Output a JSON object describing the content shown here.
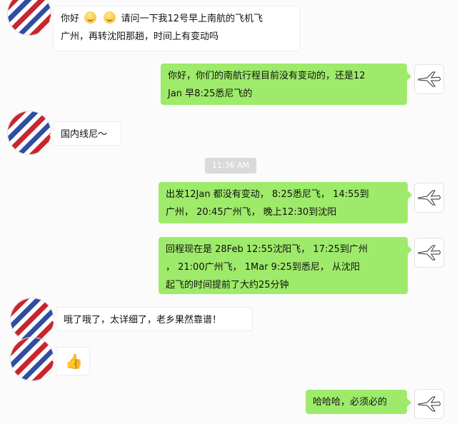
{
  "timestamp": "11:36 AM",
  "messages": [
    {
      "side": "left",
      "lines": [
        "你好",
        "请问一下我12号早上南航的飞机飞",
        "广州，再转沈阳那趟，时间上有变动吗"
      ]
    },
    {
      "side": "right",
      "lines": [
        "你好，你们的南航行程目前没有变动的，还是12",
        "Jan  早8:25悉尼飞的"
      ]
    },
    {
      "side": "left",
      "lines": [
        "国内线尼～"
      ]
    },
    {
      "side": "right",
      "lines": [
        "出发12Jan 都没有变动，  8:25悉尼飞，  14:55到",
        "广州，  20:45广州飞，  晚上12:30到沈阳"
      ]
    },
    {
      "side": "right",
      "lines": [
        " 回程现在是 28Feb 12:55沈阳飞，  17:25到广州",
        "，  21:00广州飞，  1Mar 9:25到悉尼，  从沈阳",
        "起飞的时间提前了大约25分钟"
      ]
    },
    {
      "side": "left",
      "lines": [
        "哦了哦了，太详细了，老乡果然靠谱！"
      ]
    },
    {
      "side": "left",
      "emoji": "👍"
    },
    {
      "side": "right",
      "lines": [
        "哈哈哈，必须必的"
      ]
    }
  ]
}
